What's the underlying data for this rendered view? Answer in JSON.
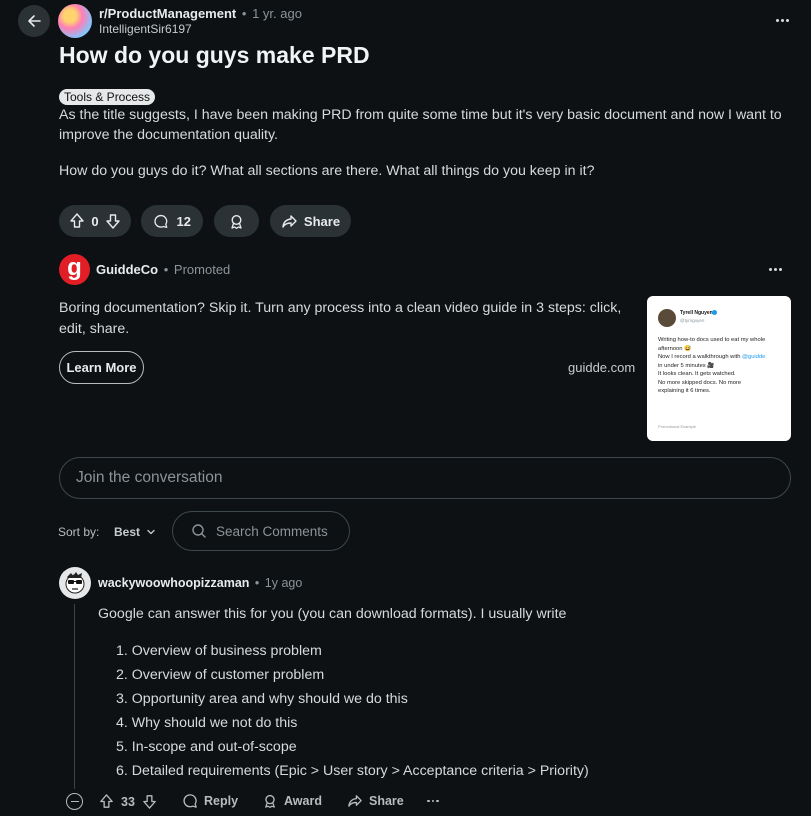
{
  "post": {
    "subreddit": "r/ProductManagement",
    "age": "1 yr. ago",
    "author": "IntelligentSir6197",
    "title": "How do you guys make PRD",
    "flair": "Tools & Process",
    "body_p1_line1": "As the title suggests, I have been making PRD from quite some time but it's very basic document and now I want to",
    "body_p1_line2": "improve the documentation quality.",
    "body_p2": "How do you guys do it? What all sections are there. What all things do you keep in it?",
    "vote_count": "0",
    "comment_count": "12",
    "share_label": "Share"
  },
  "ad": {
    "name": "GuiddeCo",
    "logo_letter": "g",
    "tag": "Promoted",
    "text_line1": "Boring documentation? Skip it. Turn any process into a clean video guide in 3 steps: click,",
    "text_line2": "edit, share.",
    "cta": "Learn More",
    "domain": "guidde.com",
    "card": {
      "name": "Tyrell Nguyen",
      "handle": "@tyrnguyen",
      "line1": "Writing how-to docs used to eat my whole",
      "line2": "afternoon 😅",
      "line3_pre": "Now I record a walkthrough with ",
      "line3_link": "@guidde",
      "line4": "in under 5 minutes 🎥",
      "line5": "It looks clean. It gets watched.",
      "line6": "No more skipped docs. No more",
      "line7": "explaining it 6 times.",
      "footer": "Promotional Example"
    }
  },
  "comment_box": {
    "placeholder": "Join the conversation"
  },
  "sort": {
    "label": "Sort by:",
    "value": "Best"
  },
  "search_comments": {
    "placeholder": "Search Comments"
  },
  "comment": {
    "user": "wackywoowhoopizzaman",
    "age": "1y ago",
    "text": "Google can answer this for you (you can download formats). I usually write",
    "list": [
      "1. Overview of business problem",
      "2. Overview of customer problem",
      "3. Opportunity area and why should we do this",
      "4. Why should we not do this",
      "5. In-scope and out-of-scope",
      "6. Detailed requirements (Epic > User story > Acceptance criteria > Priority)"
    ],
    "votes": "33",
    "reply": "Reply",
    "award": "Award",
    "share": "Share"
  },
  "icons": [
    "back-arrow-icon",
    "more-icon",
    "upvote-icon",
    "downvote-icon",
    "comment-icon",
    "award-icon",
    "share-icon",
    "search-icon",
    "chevron-down-icon",
    "collapse-icon"
  ]
}
